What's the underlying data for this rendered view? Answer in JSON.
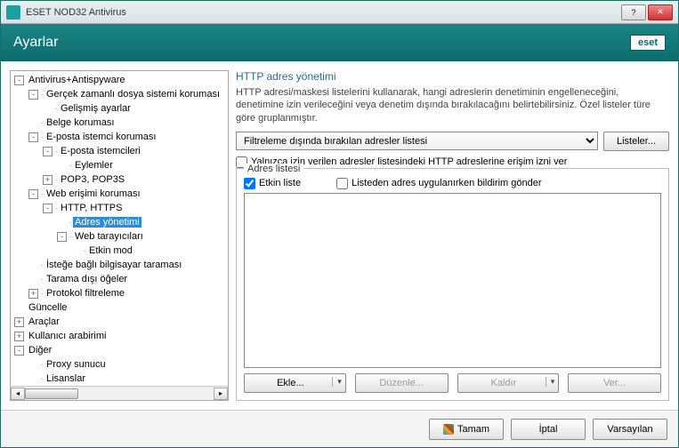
{
  "window": {
    "title": "ESET NOD32 Antivirus"
  },
  "header": {
    "title": "Ayarlar",
    "logo": "eset"
  },
  "tree": [
    {
      "depth": 0,
      "exp": "-",
      "label": "Antivirus+Antispyware"
    },
    {
      "depth": 1,
      "exp": "-",
      "label": "Gerçek zamanlı dosya sistemi koruması"
    },
    {
      "depth": 2,
      "exp": "",
      "label": "Gelişmiş ayarlar"
    },
    {
      "depth": 1,
      "exp": "",
      "label": "Belge koruması"
    },
    {
      "depth": 1,
      "exp": "-",
      "label": "E-posta istemci koruması"
    },
    {
      "depth": 2,
      "exp": "-",
      "label": "E-posta istemcileri"
    },
    {
      "depth": 3,
      "exp": "",
      "label": "Eylemler"
    },
    {
      "depth": 2,
      "exp": "+",
      "label": "POP3, POP3S"
    },
    {
      "depth": 1,
      "exp": "-",
      "label": "Web erişimi koruması"
    },
    {
      "depth": 2,
      "exp": "-",
      "label": "HTTP, HTTPS"
    },
    {
      "depth": 3,
      "exp": "",
      "label": "Adres yönetimi",
      "selected": true
    },
    {
      "depth": 3,
      "exp": "-",
      "label": "Web tarayıcıları"
    },
    {
      "depth": 4,
      "exp": "",
      "label": "Etkin mod"
    },
    {
      "depth": 1,
      "exp": "",
      "label": "İsteğe bağlı bilgisayar taraması"
    },
    {
      "depth": 1,
      "exp": "",
      "label": "Tarama dışı öğeler"
    },
    {
      "depth": 1,
      "exp": "+",
      "label": "Protokol filtreleme"
    },
    {
      "depth": 0,
      "exp": "",
      "label": "Güncelle"
    },
    {
      "depth": 0,
      "exp": "+",
      "label": "Araçlar"
    },
    {
      "depth": 0,
      "exp": "+",
      "label": "Kullanıcı arabirimi"
    },
    {
      "depth": 0,
      "exp": "-",
      "label": "Diğer"
    },
    {
      "depth": 1,
      "exp": "",
      "label": "Proxy sunucu"
    },
    {
      "depth": 1,
      "exp": "",
      "label": "Lisanslar"
    }
  ],
  "main": {
    "title": "HTTP adres yönetimi",
    "description": "HTTP adresi/maskesi listelerini kullanarak, hangi adreslerin denetiminin engelleneceğini, denetimine izin verileceğini veya denetim dışında bırakılacağını belirtebilirsiniz. Özel listeler türe göre gruplanmıştır.",
    "combo_selected": "Filtreleme dışında bırakılan adresler listesi",
    "lists_button": "Listeler...",
    "only_allowed": "Yalnızca izin verilen adresler listesindeki HTTP adreslerine erişim izni ver",
    "fieldset_legend": "Adres listesi",
    "active_list": "Etkin liste",
    "notify": "Listeden adres uygulanırken bildirim gönder",
    "buttons": {
      "add": "Ekle...",
      "edit": "Düzenle...",
      "remove": "Kaldır",
      "export": "Ver..."
    }
  },
  "footer": {
    "ok": "Tamam",
    "cancel": "İptal",
    "default": "Varsayılan"
  },
  "state": {
    "only_allowed_checked": false,
    "active_list_checked": true,
    "notify_checked": false
  }
}
